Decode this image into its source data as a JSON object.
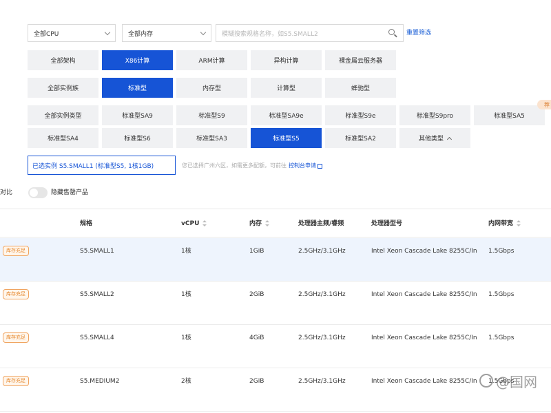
{
  "filters": {
    "cpu_select": "全部CPU",
    "memory_select": "全部内存",
    "search_placeholder": "模糊搜索规格名称，如S5.SMALL2",
    "reset_label": "重置筛选"
  },
  "architecture": [
    "全部架构",
    "X86计算",
    "ARM计算",
    "异构计算",
    "裸金属云服务器"
  ],
  "families": [
    "全部实例族",
    "标准型",
    "内存型",
    "计算型",
    "蜂驰型"
  ],
  "types_row1": [
    "全部实例类型",
    "标准型SA9",
    "标准型S9",
    "标准型SA9e",
    "标准型S9e",
    "标准型S9pro",
    "标准型SA5"
  ],
  "types_row2": [
    "标准型SA4",
    "标准型S6",
    "标准型SA3",
    "标准型S5",
    "标准型SA2",
    "其他类型"
  ],
  "type_badge": "荐",
  "selected": {
    "text": "已选实例  S5.SMALL1 (标准型S5, 1核1GB)",
    "tip": "您已选择广州六区，如需更多配额，可前往",
    "tip_link": "控制台申请"
  },
  "compare_label": "对比",
  "hide_soldout_label": "隐藏售罄产品",
  "table": {
    "headers": [
      "规格",
      "vCPU",
      "内存",
      "处理器主频/睿频",
      "处理器型号",
      "内网带宽"
    ],
    "rows": [
      {
        "status": "库存充足",
        "spec": "S5.SMALL1",
        "vcpu": "1核",
        "mem": "1GiB",
        "freq": "2.5GHz/3.1GHz",
        "model": "Intel Xeon Cascade Lake 8255C/In",
        "bw": "1.5Gbps"
      },
      {
        "status": "库存充足",
        "spec": "S5.SMALL2",
        "vcpu": "1核",
        "mem": "2GiB",
        "freq": "2.5GHz/3.1GHz",
        "model": "Intel Xeon Cascade Lake 8255C/In",
        "bw": "1.5Gbps"
      },
      {
        "status": "库存充足",
        "spec": "S5.SMALL4",
        "vcpu": "1核",
        "mem": "4GiB",
        "freq": "2.5GHz/3.1GHz",
        "model": "Intel Xeon Cascade Lake 8255C/In",
        "bw": "1.5Gbps"
      },
      {
        "status": "库存充足",
        "spec": "S5.MEDIUM2",
        "vcpu": "2核",
        "mem": "2GiB",
        "freq": "2.5GHz/3.1GHz",
        "model": "Intel Xeon Cascade Lake 8255C/In",
        "bw": "1.5Gbps"
      }
    ]
  },
  "watermark": "@国网",
  "colors": {
    "accent": "#1654d6",
    "stock": "#e6862a",
    "highlight_row": "#eef4fd"
  }
}
